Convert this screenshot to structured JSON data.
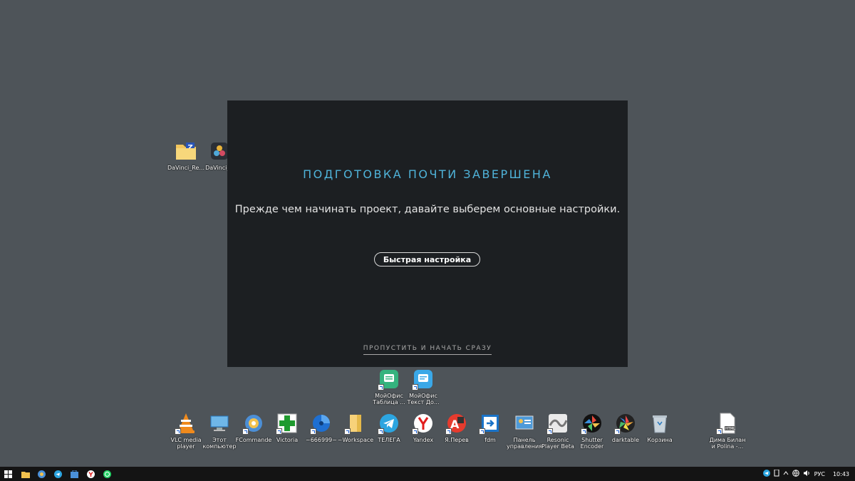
{
  "modal": {
    "title": "ПОДГОТОВКА ПОЧТИ ЗАВЕРШЕНА",
    "subtitle": "Прежде чем начинать проект, давайте выберем основные настройки.",
    "quick_setup_label": "Быстрая настройка",
    "skip_label": "ПРОПУСТИТЬ И НАЧАТЬ СРАЗУ",
    "accent_color": "#4fb3d9"
  },
  "desktop": {
    "top_icons": [
      {
        "label": "DaVinci_Re...",
        "icon": "zip-folder-icon"
      },
      {
        "label": "DaVinci_R",
        "icon": "davinci-resolve-icon"
      }
    ],
    "mid_icons": [
      {
        "label": "МойОфис Таблица ...",
        "icon": "myoffice-table-icon"
      },
      {
        "label": "МойОфис Текст До...",
        "icon": "myoffice-text-icon"
      }
    ],
    "bottom_icons": [
      {
        "label": "VLC media player",
        "icon": "vlc-icon"
      },
      {
        "label": "Этот компьютер",
        "icon": "this-pc-icon"
      },
      {
        "label": "FCommande",
        "icon": "fcommander-icon"
      },
      {
        "label": "Victoria",
        "icon": "victoria-icon"
      },
      {
        "label": "~666999~",
        "icon": "disk-icon"
      },
      {
        "label": "~Workspace",
        "icon": "folder-icon"
      },
      {
        "label": "ТЕЛЕГА",
        "icon": "telegram-icon"
      },
      {
        "label": "Yandex",
        "icon": "yandex-browser-icon"
      },
      {
        "label": "Я.Перев",
        "icon": "yandex-translate-icon"
      },
      {
        "label": "fdm",
        "icon": "fdm-icon"
      },
      {
        "label": "Панель управления",
        "icon": "control-panel-icon"
      },
      {
        "label": "Resonic Player Beta",
        "icon": "resonic-icon"
      },
      {
        "label": "Shutter Encoder",
        "icon": "shutter-encoder-icon"
      },
      {
        "label": "darktable",
        "icon": "darktable-icon"
      },
      {
        "label": "Корзина",
        "icon": "recycle-bin-icon"
      },
      {
        "label": "Дима Билан и Polina -...",
        "icon": "html-file-icon"
      }
    ]
  },
  "taskbar": {
    "pinned": [
      "start-icon",
      "file-explorer-icon",
      "chrome-icon",
      "telegram-icon",
      "store-icon",
      "yandex-icon",
      "whatsapp-icon"
    ],
    "tray": {
      "language": "РУС",
      "time": "10:43"
    }
  }
}
